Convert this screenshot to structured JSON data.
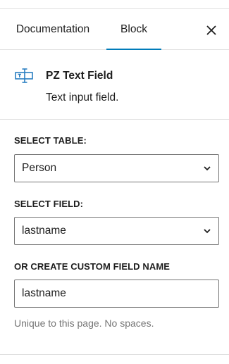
{
  "tabs": [
    {
      "label": "Documentation",
      "active": false
    },
    {
      "label": "Block",
      "active": true
    }
  ],
  "header": {
    "close_icon": "close-icon",
    "accent_color": "#007cba"
  },
  "block": {
    "icon": "text-field-icon",
    "title": "PZ Text Field",
    "description": "Text input field."
  },
  "fields": {
    "table": {
      "label": "SELECT TABLE:",
      "value": "Person"
    },
    "field": {
      "label": "SELECT FIELD:",
      "value": "lastname"
    },
    "custom": {
      "label": "OR CREATE CUSTOM FIELD NAME",
      "value": "lastname",
      "help": "Unique to this page. No spaces."
    }
  }
}
